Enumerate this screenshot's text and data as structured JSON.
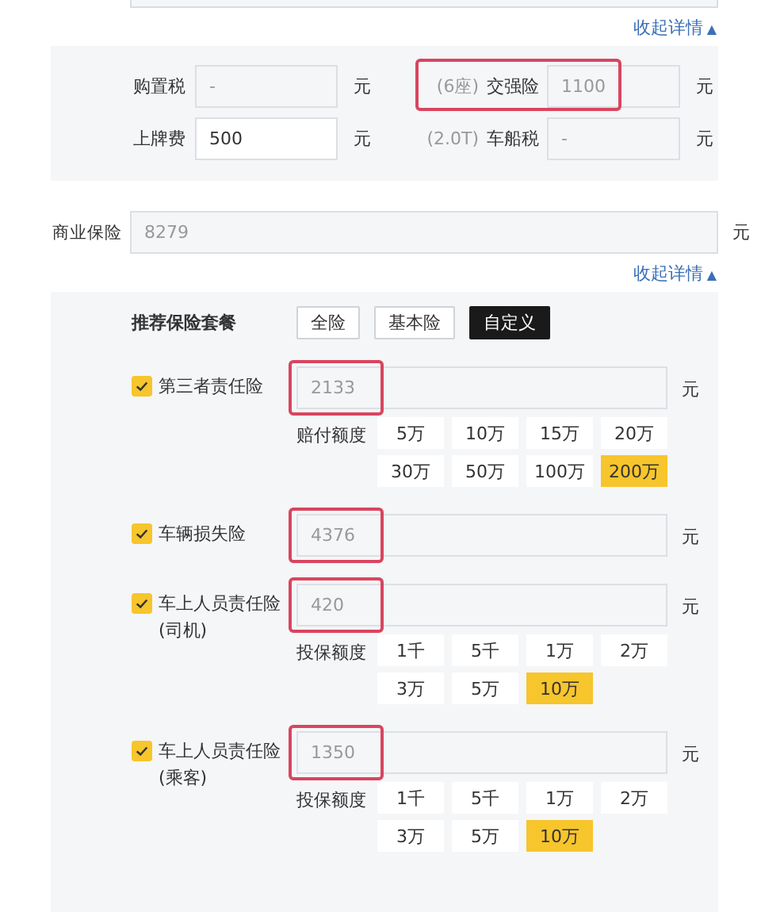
{
  "collapse_top": {
    "label": "收起详情",
    "arrow": "▲"
  },
  "fees": [
    {
      "label": "购置税",
      "value": "-",
      "unit": "元",
      "editable": false,
      "highlighted": false
    },
    {
      "note": "(6座)",
      "label": "交强险",
      "value": "1100",
      "unit": "元",
      "editable": false,
      "highlighted": true
    },
    {
      "label": "上牌费",
      "value": "500",
      "unit": "元",
      "editable": true,
      "highlighted": false
    },
    {
      "note": "(2.0T)",
      "label": "车船税",
      "value": "-",
      "unit": "元",
      "editable": false,
      "highlighted": false
    }
  ],
  "commercial": {
    "label": "商业保险",
    "value": "8279",
    "unit": "元"
  },
  "collapse_bottom": {
    "label": "收起详情",
    "arrow": "▲"
  },
  "packages": {
    "label": "推荐保险套餐",
    "options": [
      {
        "label": "全险",
        "selected": false
      },
      {
        "label": "基本险",
        "selected": false
      },
      {
        "label": "自定义",
        "selected": true
      }
    ]
  },
  "coverages": [
    {
      "label": "第三者责任险",
      "checked": true,
      "value": "2133",
      "unit": "元",
      "highlighted": true,
      "limit": {
        "label": "赔付额度",
        "options": [
          {
            "label": "5万",
            "selected": false
          },
          {
            "label": "10万",
            "selected": false
          },
          {
            "label": "15万",
            "selected": false
          },
          {
            "label": "20万",
            "selected": false
          },
          {
            "label": "30万",
            "selected": false
          },
          {
            "label": "50万",
            "selected": false
          },
          {
            "label": "100万",
            "selected": false
          },
          {
            "label": "200万",
            "selected": true
          }
        ]
      }
    },
    {
      "label": "车辆损失险",
      "checked": true,
      "value": "4376",
      "unit": "元",
      "highlighted": true
    },
    {
      "label": "车上人员责任险",
      "sublabel": "(司机)",
      "checked": true,
      "value": "420",
      "unit": "元",
      "highlighted": true,
      "limit": {
        "label": "投保额度",
        "options": [
          {
            "label": "1千",
            "selected": false
          },
          {
            "label": "5千",
            "selected": false
          },
          {
            "label": "1万",
            "selected": false
          },
          {
            "label": "2万",
            "selected": false
          },
          {
            "label": "3万",
            "selected": false
          },
          {
            "label": "5万",
            "selected": false
          },
          {
            "label": "10万",
            "selected": true
          }
        ]
      }
    },
    {
      "label": "车上人员责任险",
      "sublabel": "(乘客)",
      "checked": true,
      "value": "1350",
      "unit": "元",
      "highlighted": true,
      "limit": {
        "label": "投保额度",
        "options": [
          {
            "label": "1千",
            "selected": false
          },
          {
            "label": "5千",
            "selected": false
          },
          {
            "label": "1万",
            "selected": false
          },
          {
            "label": "2万",
            "selected": false
          },
          {
            "label": "3万",
            "selected": false
          },
          {
            "label": "5万",
            "selected": false
          },
          {
            "label": "10万",
            "selected": true
          }
        ]
      }
    }
  ]
}
